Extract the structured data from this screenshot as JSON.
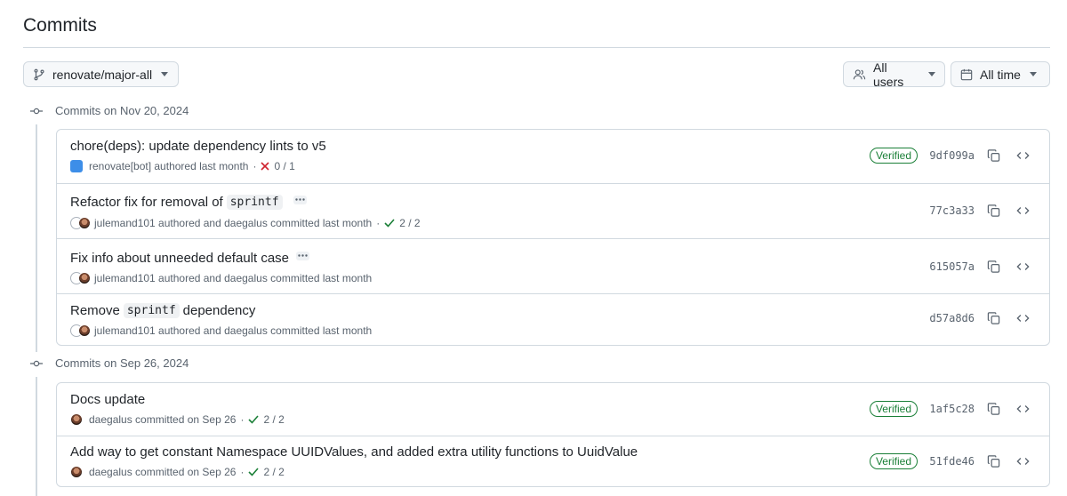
{
  "page": {
    "title": "Commits"
  },
  "toolbar": {
    "branch": {
      "label": "renovate/major-all",
      "icon": "git-branch-icon"
    },
    "users": {
      "label": "All users",
      "icon": "people-icon"
    },
    "time": {
      "label": "All time",
      "icon": "calendar-icon"
    }
  },
  "groups": [
    {
      "heading": "Commits on Nov 20, 2024",
      "commits": [
        {
          "message": "chore(deps): update dependency lints to v5",
          "meta": "renovate[bot] authored last month",
          "status": "0 / 1",
          "status_kind": "fail",
          "verified": "Verified",
          "sha": "9df099a"
        },
        {
          "message_pre": "Refactor fix for removal of",
          "code": "sprintf",
          "meta": "julemand101 authored and daegalus committed last month",
          "status": "2 / 2",
          "status_kind": "pass",
          "sha": "77c3a33"
        },
        {
          "message": "Fix info about unneeded default case",
          "meta": "julemand101 authored and daegalus committed last month",
          "sha": "615057a"
        },
        {
          "message_pre": "Remove",
          "code": "sprintf",
          "message_post": "dependency",
          "meta": "julemand101 authored and daegalus committed last month",
          "sha": "d57a8d6"
        }
      ]
    },
    {
      "heading": "Commits on Sep 26, 2024",
      "commits": [
        {
          "message": "Docs update",
          "meta": "daegalus committed on Sep 26",
          "status": "2 / 2",
          "status_kind": "pass",
          "verified": "Verified",
          "sha": "1af5c28"
        },
        {
          "message": "Add way to get constant Namespace UUIDValues, and added extra utility functions to UuidValue",
          "meta": "daegalus committed on Sep 26",
          "status": "2 / 2",
          "status_kind": "pass",
          "verified": "Verified",
          "sha": "51fde46"
        }
      ]
    }
  ],
  "colors": {
    "success": "#1a7f37",
    "danger": "#cf222e",
    "border": "#d1d9e0",
    "muted": "#59636e"
  }
}
